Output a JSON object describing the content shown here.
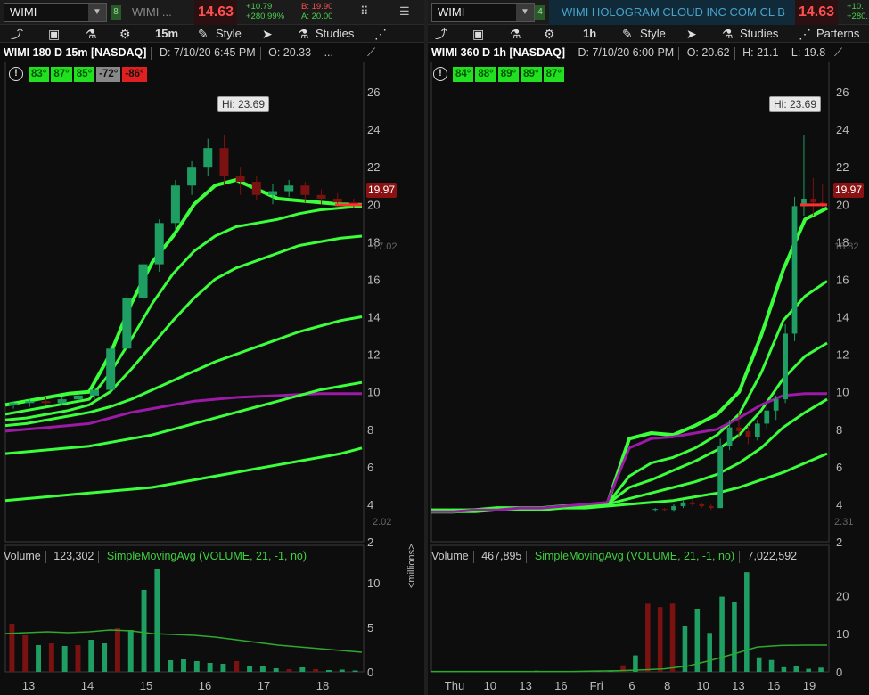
{
  "left": {
    "symbol": "WIMI",
    "desc": "WIMI ...",
    "price": "14.63",
    "change": "+10.79",
    "change_pct": "+280.99%",
    "bid": "B: 19.90",
    "ask": "A: 20.00",
    "link": "8",
    "toolbar": {
      "timeframe": "15m",
      "style": "Style",
      "studies": "Studies"
    },
    "info": {
      "title": "WIMI 180 D 15m [NASDAQ]",
      "date": "D: 7/10/20 6:45 PM",
      "open": "O: 20.33",
      "more": "..."
    },
    "meters": [
      "83°",
      "87°",
      "85°",
      "-72°",
      "-86°"
    ],
    "hi_label": "Hi: 23.69",
    "last_label": "19.97",
    "volume": {
      "label": "Volume",
      "value": "123,302",
      "sma": "SimpleMovingAvg (VOLUME, 21, -1, no)"
    },
    "units": "<millions>",
    "ghost_labels": [
      "17.02",
      "2.02"
    ]
  },
  "right": {
    "symbol": "WIMI",
    "desc": "WIMI HOLOGRAM CLOUD INC COM CL B",
    "price": "14.63",
    "change": "+10.",
    "change_pct": "+280.",
    "link": "4",
    "toolbar": {
      "timeframe": "1h",
      "style": "Style",
      "studies": "Studies",
      "patterns": "Patterns"
    },
    "info": {
      "title": "WIMI 360 D 1h [NASDAQ]",
      "date": "D: 7/10/20 6:00 PM",
      "open": "O: 20.62",
      "high": "H: 21.1",
      "low": "L: 19.8"
    },
    "meters": [
      "84°",
      "88°",
      "89°",
      "89°",
      "87°"
    ],
    "hi_label": "Hi: 23.69",
    "last_label": "19.97",
    "volume": {
      "label": "Volume",
      "value": "467,895",
      "sma": "SimpleMovingAvg (VOLUME, 21, -1, no)",
      "sma_value": "7,022,592"
    },
    "ghost_labels": [
      "18.82",
      "2.31"
    ]
  },
  "chart_data": [
    {
      "type": "candlestick",
      "title": "WIMI 180 D 15m [NASDAQ]",
      "y_ticks": [
        2,
        4,
        6,
        8,
        10,
        12,
        14,
        16,
        18,
        20,
        22,
        24,
        26
      ],
      "ylim": [
        2,
        27
      ],
      "x_ticks": [
        "13",
        "14",
        "15",
        "16",
        "17",
        "18"
      ],
      "candles": [
        [
          9.3,
          9.5,
          9.1,
          9.4
        ],
        [
          9.4,
          9.6,
          9.2,
          9.5
        ],
        [
          9.5,
          9.7,
          9.3,
          9.4
        ],
        [
          9.4,
          9.7,
          9.3,
          9.6
        ],
        [
          9.6,
          9.9,
          9.5,
          9.8
        ],
        [
          9.8,
          10.2,
          9.6,
          10.1
        ],
        [
          10.1,
          12.5,
          10,
          12.3
        ],
        [
          12.3,
          15.2,
          12,
          15
        ],
        [
          15,
          17.2,
          14.6,
          16.8
        ],
        [
          16.8,
          19.2,
          16.4,
          19
        ],
        [
          19,
          21.3,
          18.6,
          21
        ],
        [
          21,
          22.3,
          20.5,
          22
        ],
        [
          22,
          23.5,
          21.5,
          23
        ],
        [
          23,
          23.69,
          21,
          21.5
        ],
        [
          21.5,
          22,
          20.5,
          21.2
        ],
        [
          21.2,
          21.5,
          20.2,
          20.5
        ],
        [
          20.5,
          21.1,
          20,
          20.7
        ],
        [
          20.7,
          21.3,
          20.4,
          21
        ],
        [
          21,
          21.2,
          20.1,
          20.5
        ],
        [
          20.5,
          20.8,
          20,
          20.3
        ],
        [
          20.3,
          20.6,
          19.9,
          20.1
        ],
        [
          20.1,
          20.3,
          19.8,
          19.97
        ]
      ],
      "series": [
        {
          "name": "MA1",
          "values": [
            9.3,
            9.5,
            9.7,
            9.9,
            10,
            12,
            14.7,
            16.9,
            18.3,
            20,
            21,
            21.3,
            20.8,
            20.3,
            20.2,
            20.1,
            20,
            19.97
          ]
        },
        {
          "name": "MA2",
          "values": [
            8.8,
            9,
            9.2,
            9.4,
            9.6,
            11,
            12.8,
            14.7,
            16.3,
            17.5,
            18.3,
            18.8,
            19,
            19.2,
            19.5,
            19.7,
            19.8,
            19.9
          ]
        },
        {
          "name": "MA3",
          "values": [
            8.5,
            8.6,
            8.8,
            9,
            9.3,
            10,
            11.2,
            12.5,
            13.8,
            15,
            16,
            16.6,
            17,
            17.4,
            17.8,
            18,
            18.2,
            18.3
          ]
        },
        {
          "name": "MA4",
          "values": [
            8.2,
            8.3,
            8.5,
            8.7,
            8.9,
            9.2,
            9.6,
            10.1,
            10.6,
            11.1,
            11.6,
            12,
            12.4,
            12.8,
            13.2,
            13.5,
            13.8,
            14
          ]
        },
        {
          "name": "MA5",
          "values": [
            7.9,
            8,
            8.1,
            8.2,
            8.3,
            8.6,
            8.9,
            9.1,
            9.3,
            9.5,
            9.6,
            9.7,
            9.75,
            9.8,
            9.85,
            9.9,
            9.9,
            9.9
          ]
        },
        {
          "name": "MA6",
          "values": [
            6.7,
            6.8,
            6.9,
            7,
            7.1,
            7.3,
            7.5,
            7.7,
            8,
            8.3,
            8.6,
            8.9,
            9.2,
            9.5,
            9.8,
            10.1,
            10.3,
            10.5
          ]
        },
        {
          "name": "MA7",
          "values": [
            4.2,
            4.3,
            4.4,
            4.5,
            4.6,
            4.7,
            4.8,
            4.9,
            5.1,
            5.3,
            5.5,
            5.7,
            5.9,
            6.1,
            6.3,
            6.5,
            6.7,
            7
          ]
        }
      ],
      "volume_ylim": [
        0,
        12
      ],
      "volume_ticks": [
        0,
        5,
        10
      ],
      "volume": [
        5.4,
        4.1,
        3,
        3.2,
        2.9,
        3,
        3.6,
        3.2,
        4.9,
        4.7,
        9.2,
        11.5,
        1.3,
        1.4,
        1.2,
        1,
        0.9,
        1.2,
        0.7,
        0.6,
        0.4,
        0.3,
        0.5,
        0.3,
        0.2,
        0.25,
        0.15
      ],
      "volume_colors": [
        "down",
        "down",
        "up",
        "down",
        "up",
        "down",
        "up",
        "up",
        "down",
        "up",
        "up",
        "up",
        "up",
        "up",
        "up",
        "up",
        "up",
        "down",
        "up",
        "up",
        "up",
        "down",
        "up",
        "down",
        "up",
        "up",
        "up"
      ],
      "volume_sma": [
        4.3,
        4.4,
        4.5,
        4.4,
        4.5,
        4.7,
        4.6,
        4.3,
        4.2,
        4.1,
        3.9,
        3.6,
        3.3,
        3,
        2.8,
        2.6,
        2.4,
        2.2
      ]
    },
    {
      "type": "candlestick",
      "title": "WIMI 360 D 1h [NASDAQ]",
      "y_ticks": [
        2,
        4,
        6,
        8,
        10,
        12,
        14,
        16,
        18,
        20,
        22,
        24,
        26
      ],
      "ylim": [
        2,
        27
      ],
      "x_ticks": [
        "Thu",
        "10",
        "13",
        "16",
        "Fri",
        "6",
        "8",
        "10",
        "13",
        "16",
        "19"
      ],
      "candles": [
        [
          3.7,
          3.8,
          3.6,
          3.75
        ],
        [
          3.75,
          3.8,
          3.6,
          3.7
        ],
        [
          3.7,
          4,
          3.6,
          3.9
        ],
        [
          3.9,
          4.2,
          3.8,
          4.1
        ],
        [
          4.1,
          4.3,
          3.9,
          4
        ],
        [
          4,
          4.1,
          3.8,
          3.9
        ],
        [
          3.9,
          4,
          3.7,
          3.8
        ],
        [
          3.8,
          7.5,
          3.8,
          7.1
        ],
        [
          7.1,
          8.5,
          6.9,
          8.1
        ],
        [
          8.1,
          8.9,
          7.5,
          7.9
        ],
        [
          7.9,
          8.2,
          7.2,
          7.6
        ],
        [
          7.6,
          8.5,
          7.4,
          8.3
        ],
        [
          8.3,
          9.2,
          8,
          9
        ],
        [
          9,
          9.8,
          8.5,
          9.6
        ],
        [
          9.6,
          13.6,
          9.4,
          13.1
        ],
        [
          13.1,
          20.4,
          12.7,
          19.9
        ],
        [
          19.9,
          23.69,
          19.4,
          20.3
        ],
        [
          20.3,
          21.4,
          19.4,
          20.1
        ],
        [
          20.1,
          21.1,
          19.8,
          19.97
        ]
      ],
      "series": [
        {
          "name": "MA1",
          "values": [
            3.6,
            3.6,
            3.7,
            3.8,
            3.8,
            3.8,
            3.9,
            3.9,
            4,
            7.5,
            7.8,
            7.7,
            8.2,
            8.8,
            10,
            13,
            16.5,
            19.2,
            19.8
          ]
        },
        {
          "name": "MA2",
          "values": [
            3.7,
            3.7,
            3.7,
            3.8,
            3.8,
            3.8,
            3.9,
            3.9,
            4,
            5.5,
            6.2,
            6.5,
            7,
            7.7,
            8.8,
            11,
            13.8,
            15.1,
            15.9
          ]
        },
        {
          "name": "MA3",
          "values": [
            3.7,
            3.7,
            3.7,
            3.8,
            3.8,
            3.8,
            3.9,
            3.9,
            4,
            4.9,
            5.3,
            5.8,
            6.3,
            6.9,
            7.7,
            9,
            10.7,
            11.9,
            12.6
          ]
        },
        {
          "name": "MA4",
          "values": [
            3.7,
            3.7,
            3.7,
            3.8,
            3.8,
            3.8,
            3.9,
            3.9,
            4,
            4.3,
            4.6,
            4.9,
            5.2,
            5.6,
            6.2,
            7,
            8.1,
            8.9,
            9.6
          ]
        },
        {
          "name": "MA5",
          "values": [
            3.6,
            3.6,
            3.6,
            3.7,
            3.7,
            3.7,
            3.8,
            3.8,
            3.9,
            4,
            4.1,
            4.2,
            4.4,
            4.6,
            4.9,
            5.3,
            5.7,
            6.2,
            6.7
          ]
        },
        {
          "name": "MA6",
          "values": [
            3.6,
            3.6,
            3.7,
            3.7,
            3.8,
            3.8,
            3.9,
            4,
            4.1,
            7,
            7.5,
            7.6,
            7.8,
            8,
            8.6,
            9.3,
            9.8,
            9.9,
            9.9
          ]
        }
      ],
      "volume_ylim": [
        0,
        28
      ],
      "volume_ticks": [
        0,
        10,
        20
      ],
      "volume": [
        0.1,
        0.1,
        0.1,
        0.1,
        0.1,
        0.15,
        0.1,
        0.2,
        0.3,
        0.2,
        0.1,
        0.1,
        0.1,
        0.1,
        0.1,
        1.7,
        4.3,
        17.9,
        17,
        17.9,
        11.9,
        16.4,
        10.2,
        19.7,
        18.2,
        26.1,
        3.8,
        3.1,
        1.2,
        1.5,
        0.8,
        1.1
      ],
      "volume_colors": [
        "up",
        "up",
        "up",
        "up",
        "up",
        "up",
        "up",
        "up",
        "up",
        "up",
        "up",
        "up",
        "up",
        "up",
        "up",
        "down",
        "up",
        "down",
        "down",
        "down",
        "up",
        "up",
        "up",
        "up",
        "up",
        "up",
        "up",
        "up",
        "up",
        "up",
        "up",
        "up"
      ],
      "volume_sma": [
        0.1,
        0.1,
        0.1,
        0.1,
        0.1,
        0.1,
        0.1,
        0.2,
        0.3,
        0.5,
        0.8,
        1.5,
        3,
        4.7,
        6.5,
        6.9,
        7,
        7
      ]
    }
  ],
  "colors": {
    "up": "#1f9e63",
    "down": "#7a1212",
    "ma": "#3cff3c",
    "ma_magenta": "#9b1aa6",
    "price_red": "#ff5050"
  }
}
